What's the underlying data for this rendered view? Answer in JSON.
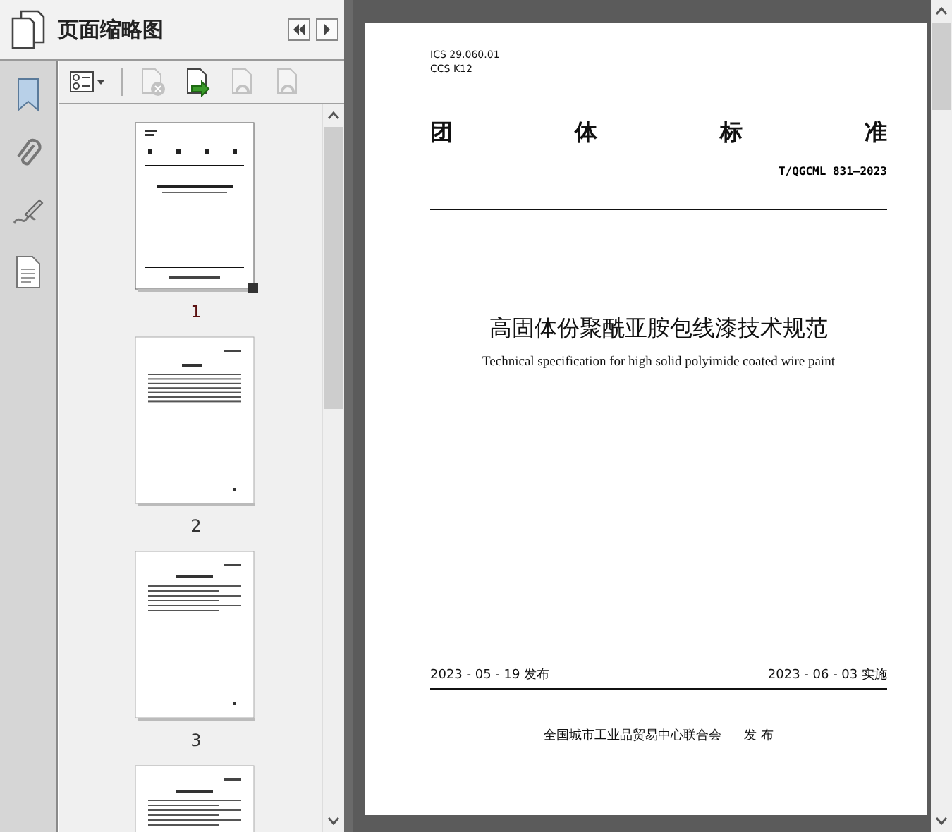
{
  "panel": {
    "title": "页面缩略图"
  },
  "toolbar": [
    {
      "kind": "options",
      "disabled": false
    },
    {
      "kind": "delete",
      "disabled": true
    },
    {
      "kind": "insert",
      "disabled": false
    },
    {
      "kind": "rotate-left",
      "disabled": true
    },
    {
      "kind": "rotate-right",
      "disabled": true
    }
  ],
  "thumbnails": [
    {
      "label": "1",
      "selected": true,
      "kind": "cover"
    },
    {
      "label": "2",
      "selected": false,
      "kind": "contents"
    },
    {
      "label": "3",
      "selected": false,
      "kind": "text"
    },
    {
      "selected": false,
      "kind": "text"
    }
  ],
  "document": {
    "ics_label": "ICS",
    "ics_value": "29.060.01",
    "ccs_label": "CCS",
    "ccs_value": "K12",
    "heading": [
      "团",
      "体",
      "标",
      "准"
    ],
    "code": "T/QGCML 831—2023",
    "title": "高固体份聚酰亚胺包线漆技术规范",
    "subtitle": "Technical specification for high solid polyimide coated wire paint",
    "publish_date": "2023 - 05 - 19 发布",
    "implement_date": "2023 - 06 - 03 实施",
    "issuer": "全国城市工业品贸易中心联合会",
    "issuer_action": "发 布"
  }
}
